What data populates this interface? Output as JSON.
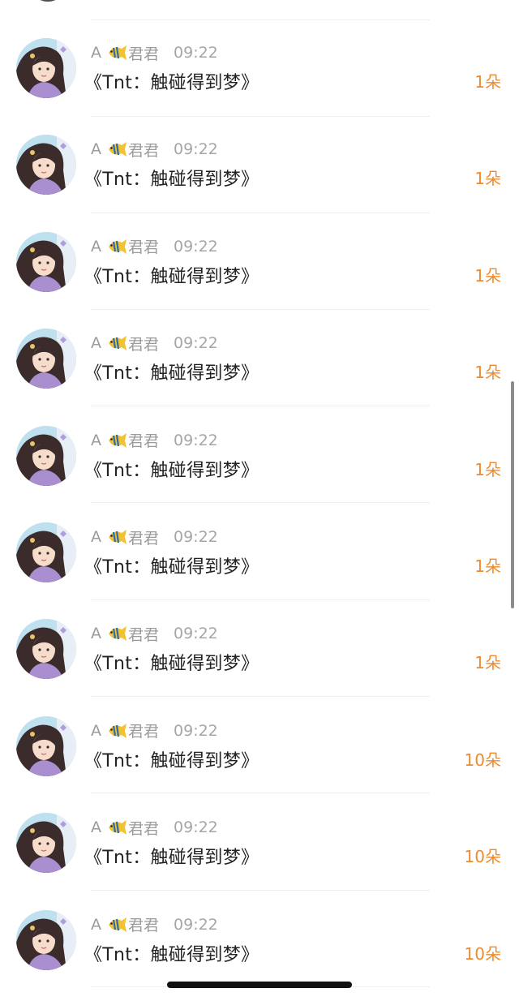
{
  "rows": [
    {
      "prefix": "A",
      "user": "君君",
      "time": "09:22",
      "title": "《Tnt：触碰得到梦》",
      "count": "1朵"
    },
    {
      "prefix": "A",
      "user": "君君",
      "time": "09:22",
      "title": "《Tnt：触碰得到梦》",
      "count": "1朵"
    },
    {
      "prefix": "A",
      "user": "君君",
      "time": "09:22",
      "title": "《Tnt：触碰得到梦》",
      "count": "1朵"
    },
    {
      "prefix": "A",
      "user": "君君",
      "time": "09:22",
      "title": "《Tnt：触碰得到梦》",
      "count": "1朵"
    },
    {
      "prefix": "A",
      "user": "君君",
      "time": "09:22",
      "title": "《Tnt：触碰得到梦》",
      "count": "1朵"
    },
    {
      "prefix": "A",
      "user": "君君",
      "time": "09:22",
      "title": "《Tnt：触碰得到梦》",
      "count": "1朵"
    },
    {
      "prefix": "A",
      "user": "君君",
      "time": "09:22",
      "title": "《Tnt：触碰得到梦》",
      "count": "1朵"
    },
    {
      "prefix": "A",
      "user": "君君",
      "time": "09:22",
      "title": "《Tnt：触碰得到梦》",
      "count": "10朵"
    },
    {
      "prefix": "A",
      "user": "君君",
      "time": "09:22",
      "title": "《Tnt：触碰得到梦》",
      "count": "10朵"
    },
    {
      "prefix": "A",
      "user": "君君",
      "time": "09:22",
      "title": "《Tnt：触碰得到梦》",
      "count": "10朵"
    }
  ],
  "icons": {
    "avatar": "user-avatar",
    "user_badge": "fish-icon"
  },
  "colors": {
    "count": "#f08a2c",
    "meta": "#9b9b9b",
    "title": "#222222"
  }
}
